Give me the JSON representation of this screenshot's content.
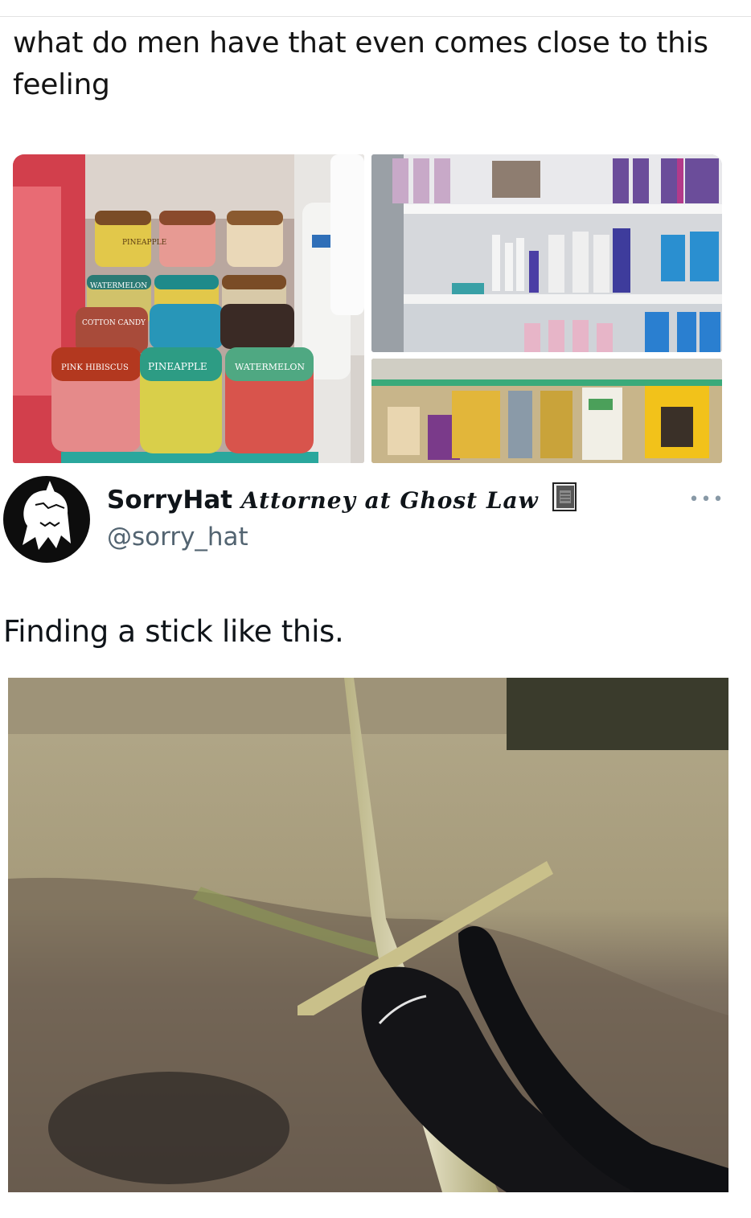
{
  "post": {
    "caption": "what do men have that even comes close to this feeling"
  },
  "photo_grid": {
    "left_label_1": "PINEAPPLE",
    "left_label_2": "WATERMELON",
    "left_label_3": "PINK HIBISCUS",
    "left_label_4": "COTTON CANDY",
    "left_label_5": "PINEAPPLE",
    "left_label_6": "WATERMELON"
  },
  "tweet": {
    "display_name": "SorryHat",
    "display_name_suffix": "Attorney at Ghost Law",
    "handle": "@sorry_hat",
    "more_label": "•••",
    "text": "Finding a stick like this."
  },
  "colors": {
    "text_primary": "#0f1419",
    "text_secondary": "#536471",
    "background": "#ffffff"
  },
  "icons": {
    "avatar": "ghost-icon",
    "badge": "book-icon",
    "more": "more-icon"
  }
}
